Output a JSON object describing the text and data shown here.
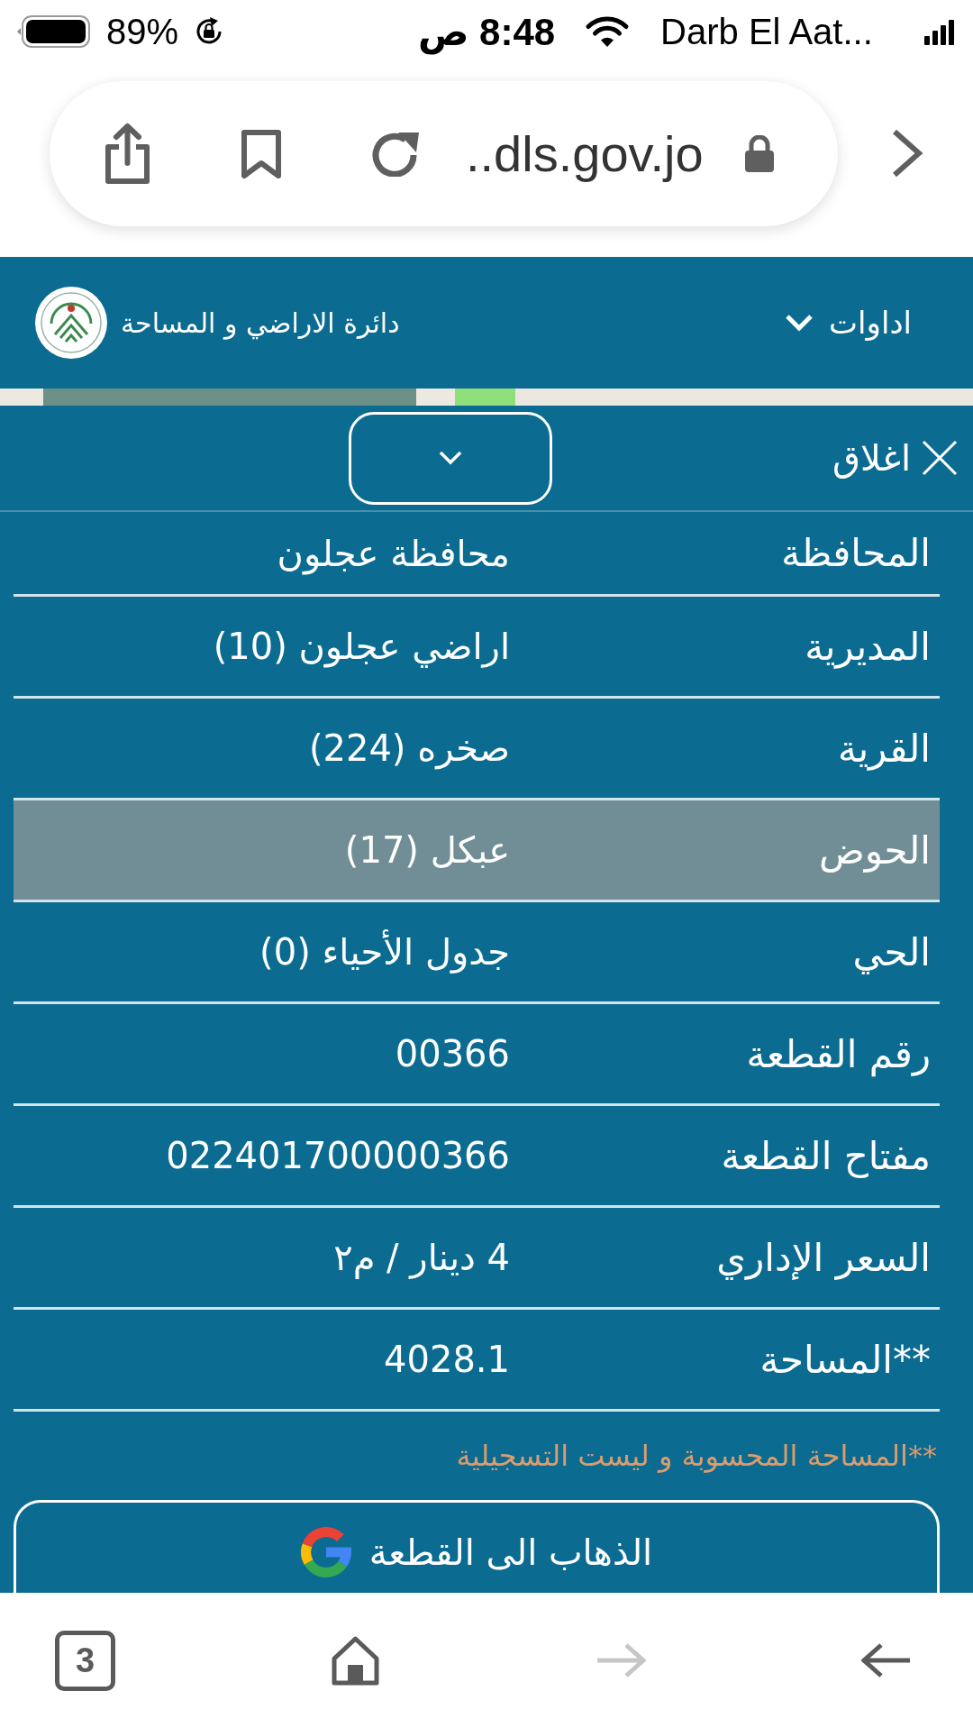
{
  "status_bar": {
    "battery": "89%",
    "time": "8:48 ص",
    "carrier": "Darb El Aat..."
  },
  "browser": {
    "url": "..dls.gov.jo"
  },
  "header": {
    "title": "دائرة الاراضي و المساحة",
    "menu": "اداوات"
  },
  "panel": {
    "close": "اغلاق",
    "rows": [
      {
        "label": "المحافظة",
        "value": "محافظة عجلون",
        "selected": false
      },
      {
        "label": "المديرية",
        "value": "اراضي عجلون (10)",
        "selected": false
      },
      {
        "label": "القرية",
        "value": "صخره (224)",
        "selected": false
      },
      {
        "label": "الحوض",
        "value": "عبكل (17)",
        "selected": true
      },
      {
        "label": "الحي",
        "value": "جدول الأحياء (0)",
        "selected": false
      },
      {
        "label": "رقم القطعة",
        "value": "00366",
        "selected": false
      },
      {
        "label": "مفتاح القطعة",
        "value": "022401700000366",
        "selected": false
      },
      {
        "label": "السعر الإداري",
        "value": "4 دينار / م٢",
        "selected": false
      },
      {
        "label": "**المساحة",
        "value": "4028.1",
        "selected": false
      }
    ],
    "note": "**المساحة المحسوبة و ليست التسجيلية",
    "action": "الذهاب الى القطعة"
  },
  "bottom_bar": {
    "items": [
      {
        "kind": "tabs",
        "label": "3",
        "disabled": false
      },
      {
        "kind": "home",
        "disabled": false
      },
      {
        "kind": "forward",
        "disabled": true
      },
      {
        "kind": "back",
        "disabled": false
      }
    ]
  }
}
